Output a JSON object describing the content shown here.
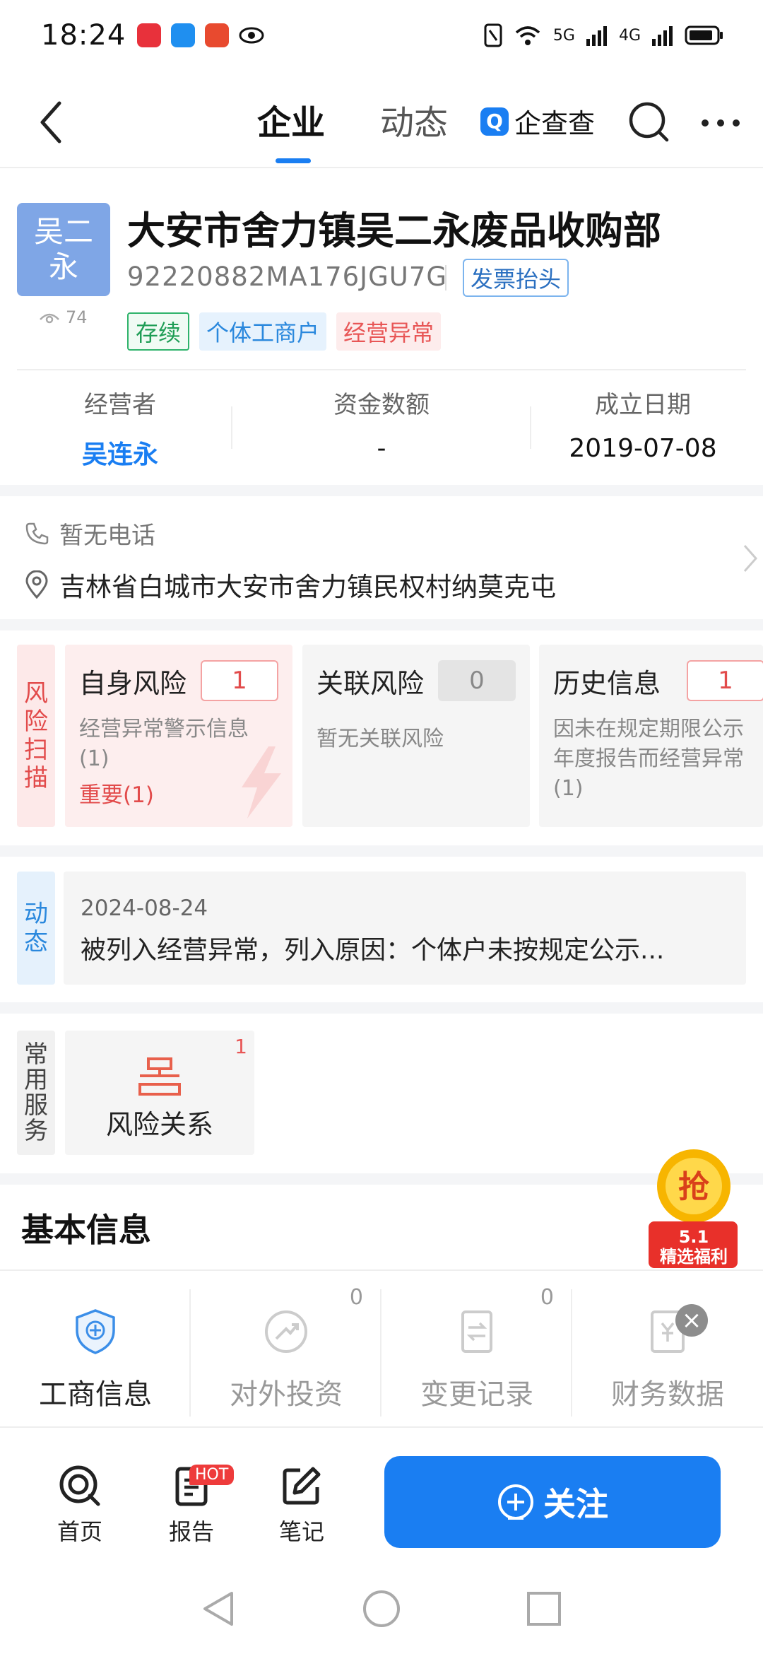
{
  "status_bar": {
    "time": "18:24",
    "network1": "5G",
    "network2": "4G"
  },
  "header": {
    "tabs": [
      "企业",
      "动态"
    ],
    "brand": "企查查"
  },
  "company": {
    "logo_text": [
      "吴二",
      "永"
    ],
    "views": "74",
    "name": "大安市舍力镇吴二永废品收购部",
    "credit_code": "92220882MA176JGU7G",
    "invoice_button": "发票抬头",
    "tags": [
      "存续",
      "个体工商户",
      "经营异常"
    ]
  },
  "stats": [
    {
      "label": "经营者",
      "value": "吴连永"
    },
    {
      "label": "资金数额",
      "value": "-"
    },
    {
      "label": "成立日期",
      "value": "2019-07-08"
    }
  ],
  "contact": {
    "phone": "暂无电话",
    "address": "吉林省白城市大安市舍力镇民权村纳莫克屯"
  },
  "risk_scan": {
    "side_label": [
      "风",
      "险",
      "扫",
      "描"
    ],
    "cards": [
      {
        "title": "自身风险",
        "count": "1",
        "desc": "经营异常警示信息(1)",
        "important": "重要(1)"
      },
      {
        "title": "关联风险",
        "count": "0",
        "desc": "暂无关联风险"
      },
      {
        "title": "历史信息",
        "count": "1",
        "desc": "因未在规定期限公示年度报告而经营异常(1)"
      }
    ]
  },
  "dynamics": {
    "side_label": [
      "动",
      "态"
    ],
    "date": "2024-08-24",
    "text": "被列入经营异常，列入原因：个体户未按规定公示..."
  },
  "services": {
    "side_label": [
      "常",
      "用",
      "服",
      "务"
    ],
    "items": [
      {
        "label": "风险关系",
        "badge": "1"
      }
    ]
  },
  "basic_info": {
    "title": "基本信息",
    "items": [
      {
        "label": "工商信息",
        "count": ""
      },
      {
        "label": "对外投资",
        "count": "0"
      },
      {
        "label": "变更记录",
        "count": "0"
      },
      {
        "label": "财务数据",
        "count": ""
      }
    ]
  },
  "promo": {
    "top": "抢",
    "line1": "5.1",
    "line2": "精选福利"
  },
  "bottom_nav": {
    "items": [
      {
        "label": "首页"
      },
      {
        "label": "报告",
        "badge": "HOT"
      },
      {
        "label": "笔记"
      }
    ],
    "follow_button": "关注"
  },
  "colors": {
    "primary": "#1a7ef2",
    "danger": "#e24b4b",
    "success": "#1e9d55"
  }
}
